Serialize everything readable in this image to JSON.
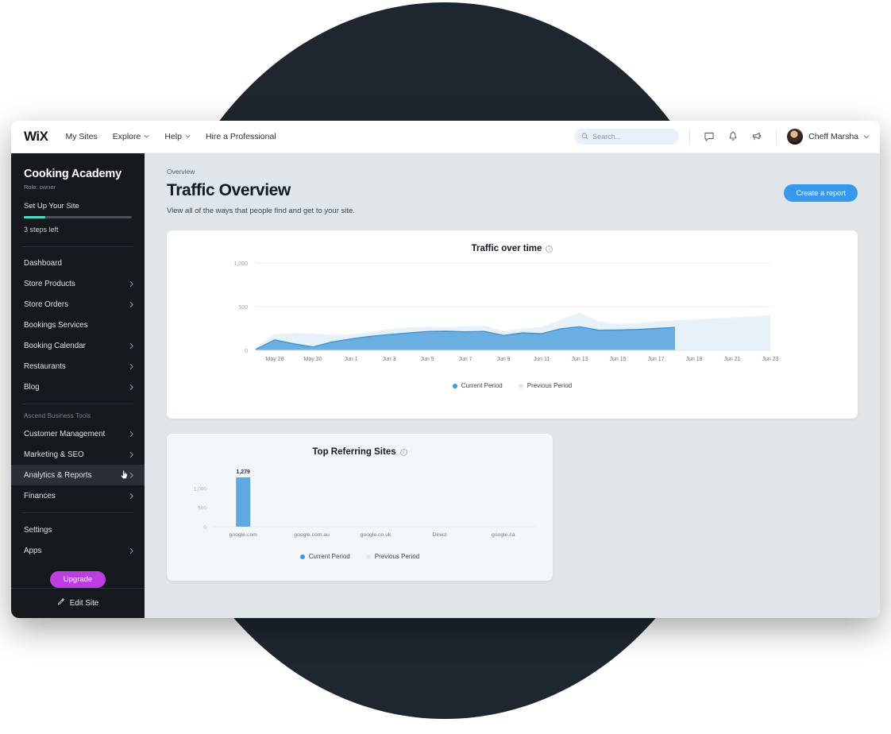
{
  "topbar": {
    "logo": "WiX",
    "nav": [
      {
        "label": "My Sites",
        "caret": false
      },
      {
        "label": "Explore",
        "caret": true
      },
      {
        "label": "Help",
        "caret": true
      },
      {
        "label": "Hire a Professional",
        "caret": false
      }
    ],
    "search_placeholder": "Search...",
    "icons": [
      "chat-icon",
      "bell-icon",
      "megaphone-icon"
    ],
    "user_name": "Cheff Marsha"
  },
  "sidebar": {
    "site_title": "Cooking Academy",
    "role": "Role: owner",
    "setup_label": "Set Up Your Site",
    "progress_percent": 20,
    "steps_left": "3 steps left",
    "items": [
      {
        "label": "Dashboard",
        "chevron": false,
        "active": false
      },
      {
        "label": "Store Products",
        "chevron": true,
        "active": false
      },
      {
        "label": "Store Orders",
        "chevron": true,
        "active": false
      },
      {
        "label": "Bookings Services",
        "chevron": false,
        "active": false
      },
      {
        "label": "Booking Calendar",
        "chevron": true,
        "active": false
      },
      {
        "label": "Restaurants",
        "chevron": true,
        "active": false
      },
      {
        "label": "Blog",
        "chevron": true,
        "active": false
      }
    ],
    "group_label": "Ascend Business Tools",
    "items2": [
      {
        "label": "Customer Management",
        "chevron": true,
        "active": false
      },
      {
        "label": "Marketing & SEO",
        "chevron": true,
        "active": false
      },
      {
        "label": "Analytics & Reports",
        "chevron": true,
        "active": true
      },
      {
        "label": "Finances",
        "chevron": true,
        "active": false
      }
    ],
    "items3": [
      {
        "label": "Settings",
        "chevron": false,
        "active": false
      },
      {
        "label": "Apps",
        "chevron": true,
        "active": false
      }
    ],
    "upgrade_label": "Upgrade",
    "edit_site_label": "Edit Site"
  },
  "main": {
    "breadcrumb": "Overview",
    "title": "Traffic Overview",
    "subtitle": "View all of the ways that people find and get to your site.",
    "create_report_label": "Create a report"
  },
  "colors": {
    "accent_blue": "#3899ec",
    "series_current": "#5fa8e0",
    "series_previous": "#e3eef8",
    "upgrade_purple": "#bb3ee0",
    "progress_green": "#49dfc0",
    "sidebar_bg": "#15181d",
    "page_bg": "#dfe5e8",
    "backdrop_circle": "#1e2630"
  },
  "chart_data": [
    {
      "type": "area",
      "title": "Traffic over time",
      "xlabel": "",
      "ylabel": "",
      "ylim": [
        0,
        1000
      ],
      "yticks": [
        0,
        500,
        1000
      ],
      "ytick_labels": [
        "0",
        "500",
        "1,000"
      ],
      "grid": true,
      "legend_position": "bottom",
      "x": [
        "May 27",
        "May 28",
        "May 29",
        "May 30",
        "May 31",
        "Jun 1",
        "Jun 2",
        "Jun 3",
        "Jun 4",
        "Jun 5",
        "Jun 6",
        "Jun 7",
        "Jun 8",
        "Jun 9",
        "Jun 10",
        "Jun 11",
        "Jun 12",
        "Jun 13",
        "Jun 14",
        "Jun 15",
        "Jun 16",
        "Jun 17",
        "Jun 18",
        "Jun 19",
        "Jun 20",
        "Jun 21",
        "Jun 22",
        "Jun 23"
      ],
      "xtick_labels": [
        "May 28",
        "May 30",
        "Jun 1",
        "Jun 3",
        "Jun 5",
        "Jun 7",
        "Jun 9",
        "Jun 11",
        "Jun 13",
        "Jun 15",
        "Jun 17",
        "Jun 19",
        "Jun 21",
        "Jun 23"
      ],
      "series": [
        {
          "name": "Current Period",
          "color": "#5fa8e0",
          "values": [
            10,
            120,
            75,
            38,
            95,
            130,
            160,
            180,
            198,
            215,
            218,
            212,
            216,
            170,
            200,
            190,
            245,
            270,
            230,
            232,
            238,
            250,
            262,
            null,
            null,
            null,
            null,
            null
          ]
        },
        {
          "name": "Previous Period",
          "color": "#e3eef8",
          "values": [
            25,
            185,
            195,
            192,
            175,
            182,
            205,
            240,
            258,
            268,
            262,
            272,
            278,
            215,
            248,
            262,
            350,
            430,
            330,
            300,
            305,
            330,
            340,
            352,
            360,
            372,
            385,
            400
          ]
        }
      ]
    },
    {
      "type": "bar",
      "title": "Top Referring Sites",
      "xlabel": "",
      "ylabel": "",
      "ylim": [
        0,
        1400
      ],
      "yticks": [
        0,
        500,
        1000
      ],
      "ytick_labels": [
        "0",
        "500",
        "1,000"
      ],
      "grid": false,
      "legend_position": "bottom",
      "categories": [
        "google.com",
        "google.com.au",
        "google.co.uk",
        "Direct",
        "google.ca"
      ],
      "data_labels": [
        "1,279",
        "",
        "",
        "",
        ""
      ],
      "series": [
        {
          "name": "Current Period",
          "color": "#5fa8e0",
          "values": [
            1279,
            0,
            0,
            0,
            0
          ]
        },
        {
          "name": "Previous Period",
          "color": "#e3eef8",
          "values": [
            0,
            0,
            0,
            0,
            0
          ]
        }
      ]
    }
  ],
  "legend": {
    "current": "Current Period",
    "previous": "Previous Period"
  }
}
